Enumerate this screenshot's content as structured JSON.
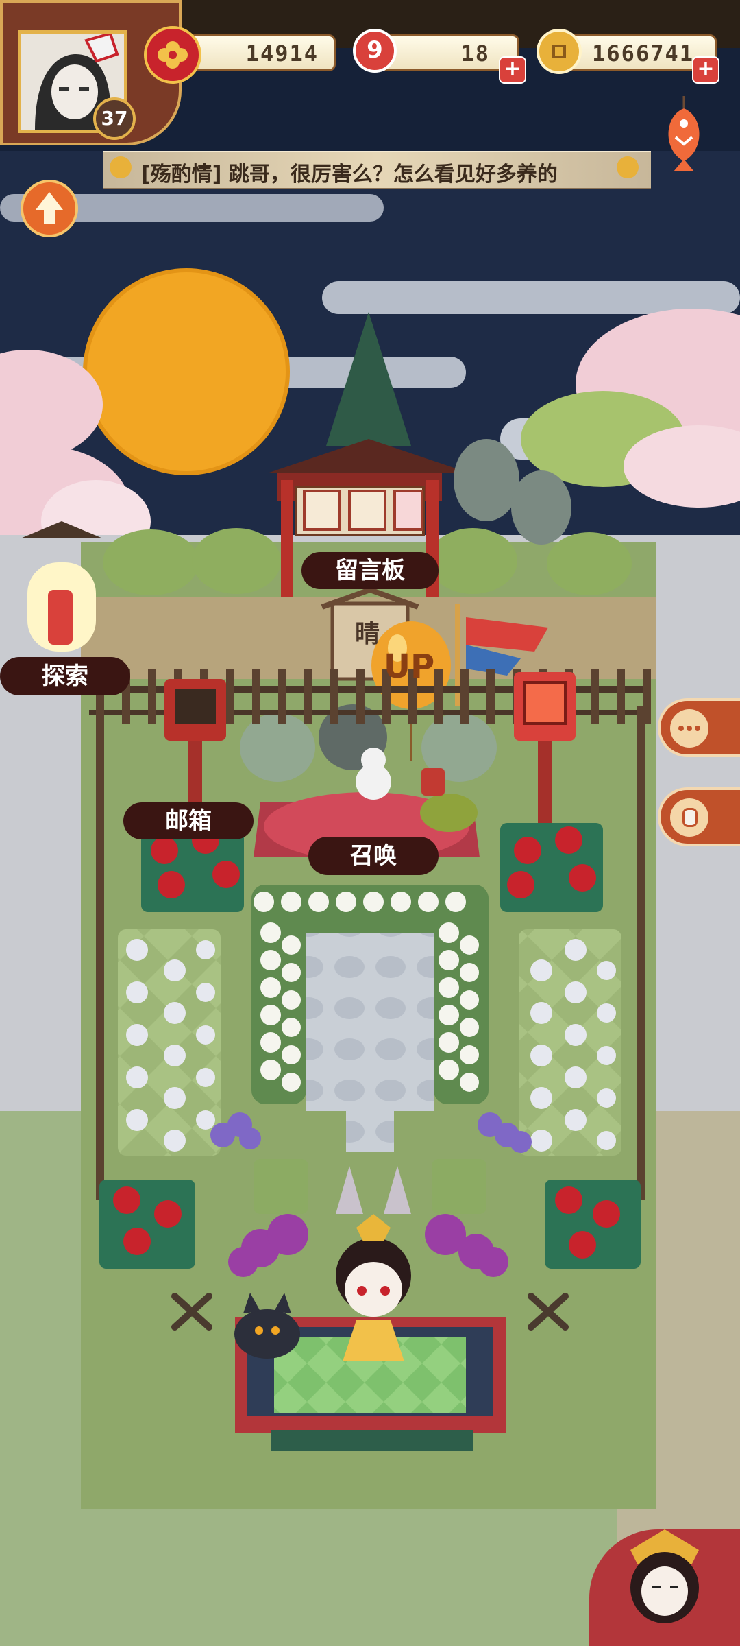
{
  "player": {
    "level": "37",
    "avatar_icon": "player-portrait-icon"
  },
  "resources": {
    "stamina": {
      "icon": "sakura-crest-icon",
      "value": "14914"
    },
    "tickets": {
      "icon": "red-ticket-icon",
      "value": "18"
    },
    "coins": {
      "icon": "gold-coin-icon",
      "value": "1666741"
    }
  },
  "chat_ticker": {
    "text": "[殇酌情] 跳哥，很厉害么？怎么看见好多养的"
  },
  "courtyard": {
    "message_board": "留言板",
    "explore": "探索",
    "mailbox": "邮箱",
    "summon": "召唤",
    "balloon": "UP",
    "shrine_sign": "晴"
  },
  "side_buttons": {
    "chat": "chat-bubble-icon",
    "gift": "gift-bag-icon"
  },
  "icons": {
    "level_up": "lantern-up-arrow-icon",
    "koi": "koi-fish-icon",
    "character_menu": "character-portrait-icon"
  },
  "colors": {
    "sky": "#1e2b46",
    "moon": "#f2a623",
    "grass": "#8fa86a",
    "hud_brown": "#8b3f2a",
    "accent_red": "#d9413b"
  }
}
